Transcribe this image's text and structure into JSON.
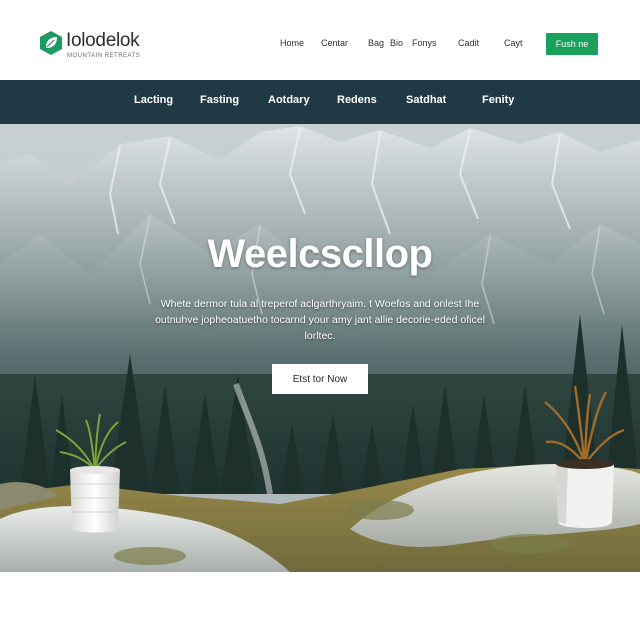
{
  "brand": {
    "name": "Iolodelok",
    "tagline": "MOUNTAIN RETREATS"
  },
  "topnav": {
    "items": [
      "Home",
      "Centar",
      "Bag",
      "Bio",
      "Fonys",
      "Cadit",
      "Cayt"
    ]
  },
  "cta": {
    "label": "Fush ne"
  },
  "mainnav": {
    "items": [
      "Lacting",
      "Fasting",
      "Aotdary",
      "Redens",
      "Satdhat",
      "Fenity"
    ]
  },
  "hero": {
    "title": "Weelcscllop",
    "text": "Whete dermor tula al treperof aclgarthryaim. t Woefos and onlest Ihe outnuhve jopheoatuetho tocarnd your amy jant allie decorie-eded oficel lorltec.",
    "button_label": "Etst tor Now"
  },
  "colors": {
    "navbar_bg": "#213845",
    "cta_bg": "#19a05a",
    "logo_accent": "#1c9a5f"
  },
  "icons": {
    "logo": "hexagon-leaf-icon",
    "plant_left": "potted-fern-illustration",
    "plant_right": "potted-plant-illustration"
  }
}
